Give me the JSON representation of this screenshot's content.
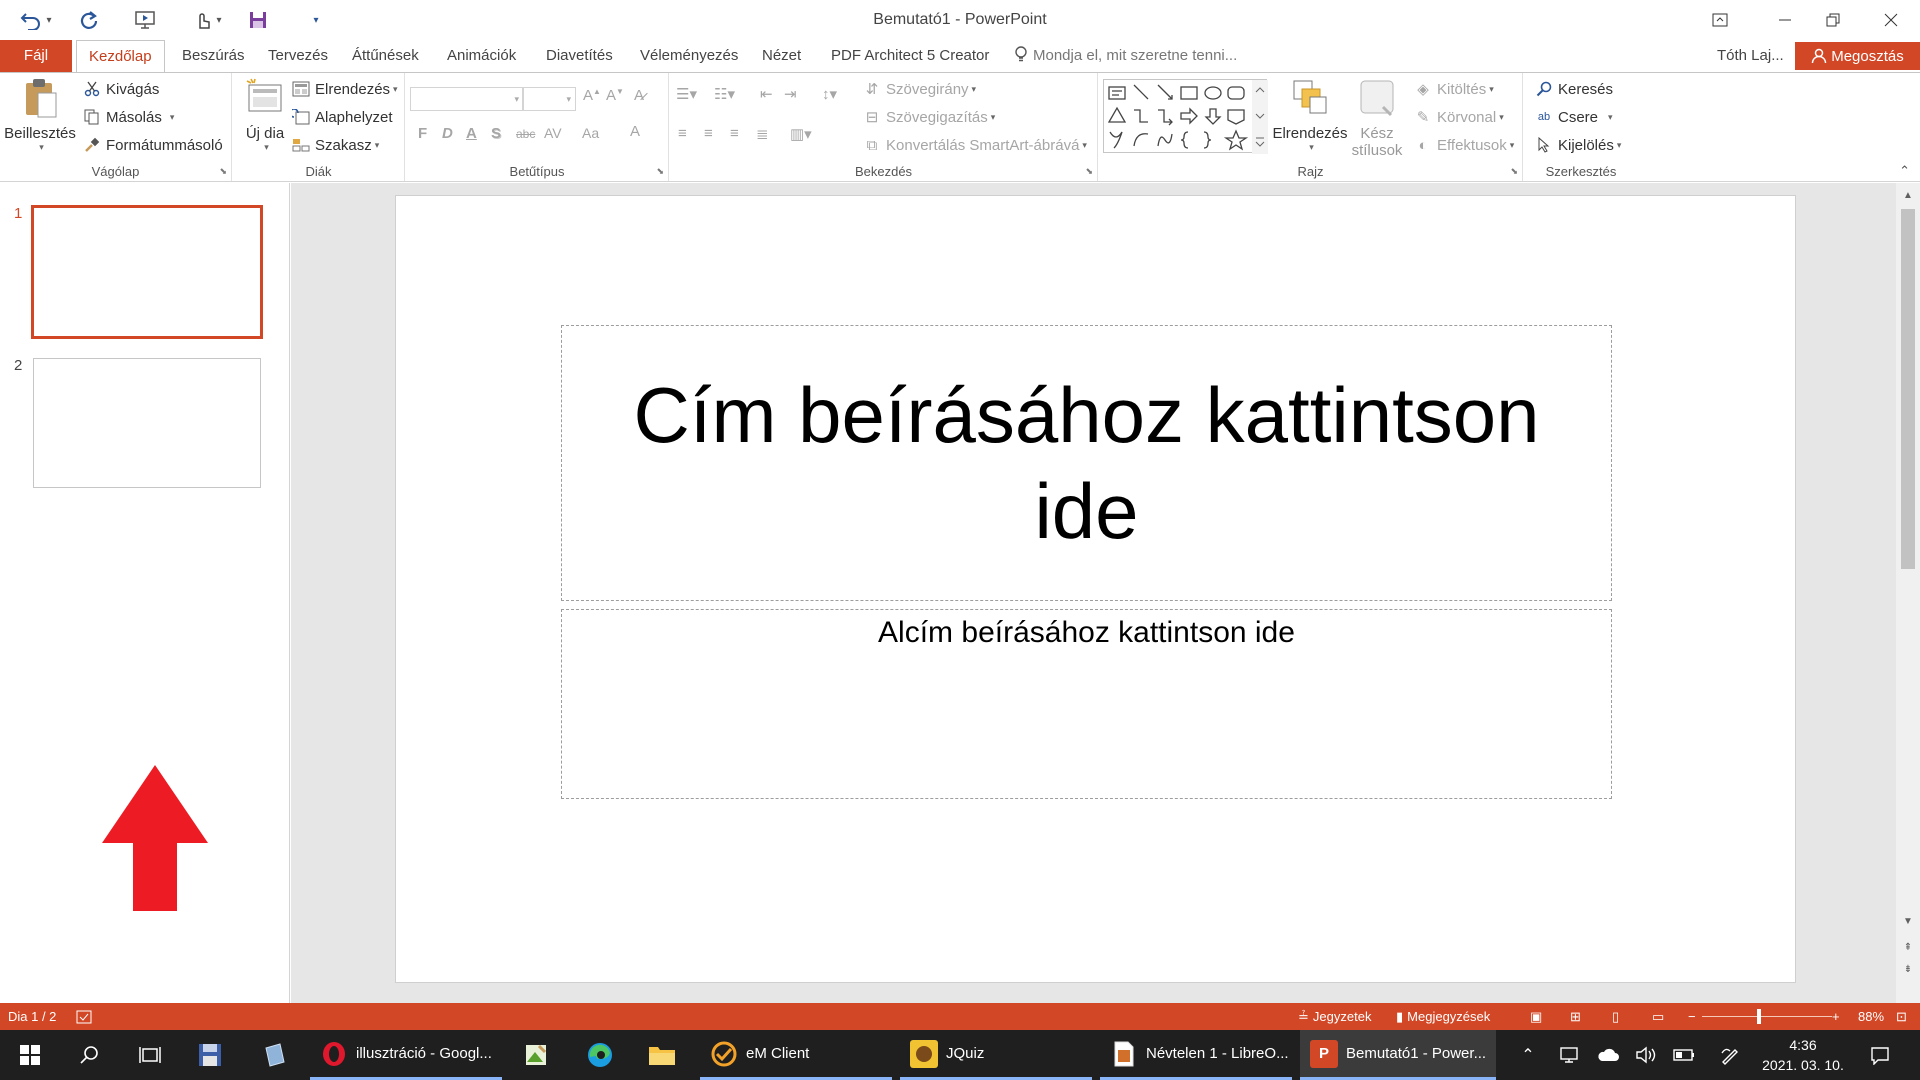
{
  "window": {
    "title": "Bemutató1 - PowerPoint"
  },
  "tabs": {
    "file": "Fájl",
    "items": [
      "Kezdőlap",
      "Beszúrás",
      "Tervezés",
      "Áttűnések",
      "Animációk",
      "Diavetítés",
      "Véleményezés",
      "Nézet",
      "PDF Architect 5 Creator"
    ],
    "active": "Kezdőlap",
    "tell_me": "Mondja el, mit szeretne tenni...",
    "user": "Tóth Laj...",
    "share": "Megosztás"
  },
  "ribbon": {
    "clipboard": {
      "label": "Vágólap",
      "paste": "Beillesztés",
      "cut": "Kivágás",
      "copy": "Másolás",
      "format_painter": "Formátummásoló"
    },
    "slides": {
      "label": "Diák",
      "new_slide": "Új dia",
      "layout": "Elrendezés",
      "reset": "Alaphelyzet",
      "section": "Szakasz"
    },
    "font": {
      "label": "Betűtípus",
      "bold": "F",
      "italic": "D",
      "underline": "A",
      "shadow": "S",
      "strike": "abc",
      "spacing": "AV",
      "case": "Aa",
      "color": "A"
    },
    "paragraph": {
      "label": "Bekezdés",
      "text_direction": "Szövegirány",
      "align_text": "Szövegigazítás",
      "smartart": "Konvertálás SmartArt-ábrává"
    },
    "drawing": {
      "label": "Rajz",
      "arrange": "Elrendezés",
      "quick_styles_1": "Kész",
      "quick_styles_2": "stílusok",
      "fill": "Kitöltés",
      "outline": "Körvonal",
      "effects": "Effektusok"
    },
    "editing": {
      "label": "Szerkesztés",
      "find": "Keresés",
      "replace": "Csere",
      "select": "Kijelölés"
    }
  },
  "thumbnails": [
    {
      "number": "1",
      "active": true
    },
    {
      "number": "2",
      "active": false
    }
  ],
  "slide": {
    "title_placeholder": "Cím beírásához kattintson ide",
    "subtitle_placeholder": "Alcím beírásához kattintson ide"
  },
  "statusbar": {
    "slide_info": "Dia 1 / 2",
    "notes": "Jegyzetek",
    "comments": "Megjegyzések",
    "zoom": "88%",
    "zoom_fraction": 0.44
  },
  "taskbar": {
    "apps": [
      {
        "label": "illusztráció - Googl...",
        "icon": "opera-icon"
      },
      {
        "label": "eM Client",
        "icon": "emclient-icon"
      },
      {
        "label": "JQuiz",
        "icon": "jquiz-icon"
      },
      {
        "label": "Névtelen 1 - LibreO...",
        "icon": "libreoffice-icon"
      },
      {
        "label": "Bemutató1 - Power...",
        "icon": "powerpoint-icon"
      }
    ],
    "time": "4:36",
    "date": "2021. 03. 10."
  },
  "colors": {
    "accent": "#d24726",
    "arrow": "#ed1c24",
    "taskbar": "#1f1f1f"
  }
}
